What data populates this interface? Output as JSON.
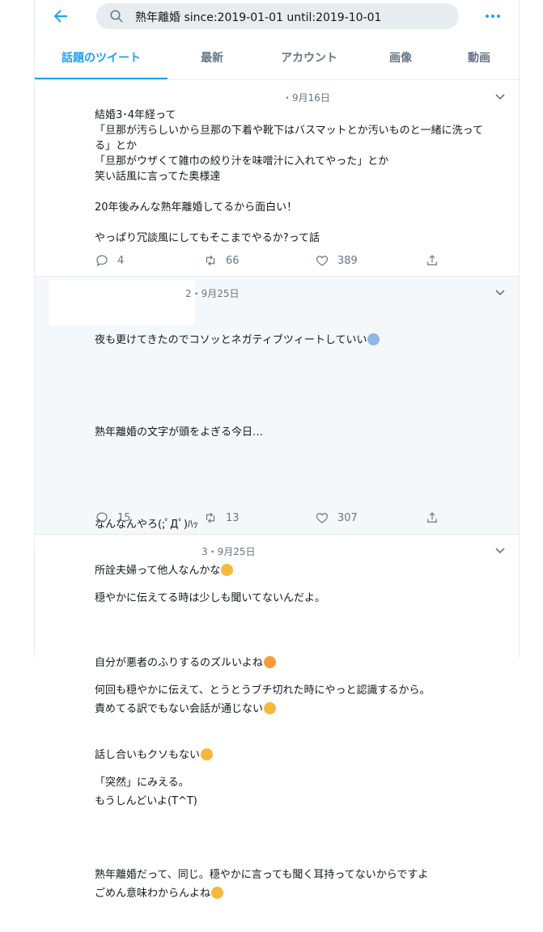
{
  "search": {
    "query": "熟年離婚 since:2019-01-01 until:2019-10-01"
  },
  "tabs": [
    {
      "label": "話題のツイート"
    },
    {
      "label": "最新"
    },
    {
      "label": "アカウント"
    },
    {
      "label": "画像"
    },
    {
      "label": "動画"
    }
  ],
  "tweets": [
    {
      "date": "・9月16日",
      "text": "結婚3･4年経って\n「旦那が汚らしいから旦那の下着や靴下はバスマットとか汚いものと一緒に洗って\nる」とか\n「旦那がウザくて雑巾の絞り汁を味噌汁に入れてやった」とか\n笑い話風に言ってた奥様達\n\n20年後みんな熟年離婚してるから面白い！\n\nやっぱり冗談風にしてもそこまでやるか?って話",
      "replies": "4",
      "retweets": "66",
      "likes": "389"
    },
    {
      "date": "2・9月25日",
      "lines": [
        "夜も更けてきたのでコソッとネガティブツィートしていい",
        "",
        "熟年離婚の文字が頭をよぎる今日…",
        "",
        "なんなんやろ(;ﾟДﾟ)ﾊｯ",
        "所詮夫婦って他人なんかな",
        "",
        "自分が悪者のふりするのズルいよね",
        "責めてる訳でもない会話が通じない",
        "話し合いもクソもない",
        "もうしんどいよ(T^T)",
        "",
        "ごめん意味わからんよね"
      ],
      "replies": "15",
      "retweets": "13",
      "likes": "307"
    },
    {
      "date": "3・9月25日",
      "lines": [
        "穏やかに伝えてる時は少しも聞いてないんだよ。",
        "",
        "何回も穏やかに伝えて、とうとうブチ切れた時にやっと認識するから。",
        "",
        "「突然」にみえる。",
        "",
        "熟年離婚だって、同じ。穏やかに言っても聞く耳持ってないからですよ"
      ]
    }
  ],
  "icons": {
    "back": "back-arrow-icon",
    "search": "search-icon",
    "more": "more-dots-icon",
    "caret": "chevron-down-icon",
    "reply": "reply-icon",
    "retweet": "retweet-icon",
    "like": "heart-icon",
    "share": "share-icon"
  },
  "colors": {
    "accent": "#1da1f2",
    "muted": "#657786",
    "emoji": "#f5b93b"
  }
}
